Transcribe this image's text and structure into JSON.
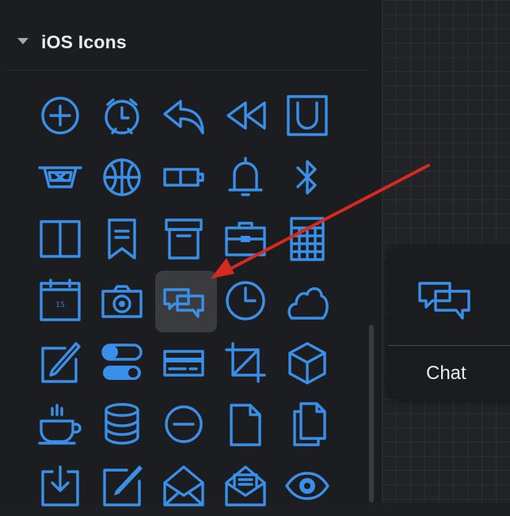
{
  "panel": {
    "title": "iOS Icons",
    "icon_color": "#3a8fe8",
    "icons": [
      [
        "plus-circle-icon",
        "alarm-clock-icon",
        "reply-icon",
        "rewind-icon",
        "magnet-icon"
      ],
      [
        "washing-icon",
        "basketball-icon",
        "battery-icon",
        "bell-icon",
        "bluetooth-icon"
      ],
      [
        "book-icon",
        "bookmark-icon",
        "archive-box-icon",
        "briefcase-icon",
        "calculator-icon"
      ],
      [
        "calendar-icon",
        "camera-icon",
        "chat-icon",
        "clock-icon",
        "cloud-icon"
      ],
      [
        "compose-icon",
        "toggle-switches-icon",
        "credit-card-icon",
        "crop-icon",
        "cube-icon"
      ],
      [
        "coffee-cup-icon",
        "database-icon",
        "minus-circle-icon",
        "document-icon",
        "documents-icon"
      ],
      [
        "download-icon",
        "edit-icon",
        "envelope-open-icon",
        "envelope-letter-icon",
        "eye-icon"
      ]
    ],
    "selected_icon": "chat-icon",
    "calendar_day": "15"
  },
  "canvas": {
    "card": {
      "label": "Chat",
      "icon": "chat-icon"
    }
  },
  "annotation": {
    "arrow_color": "#d42a20"
  }
}
